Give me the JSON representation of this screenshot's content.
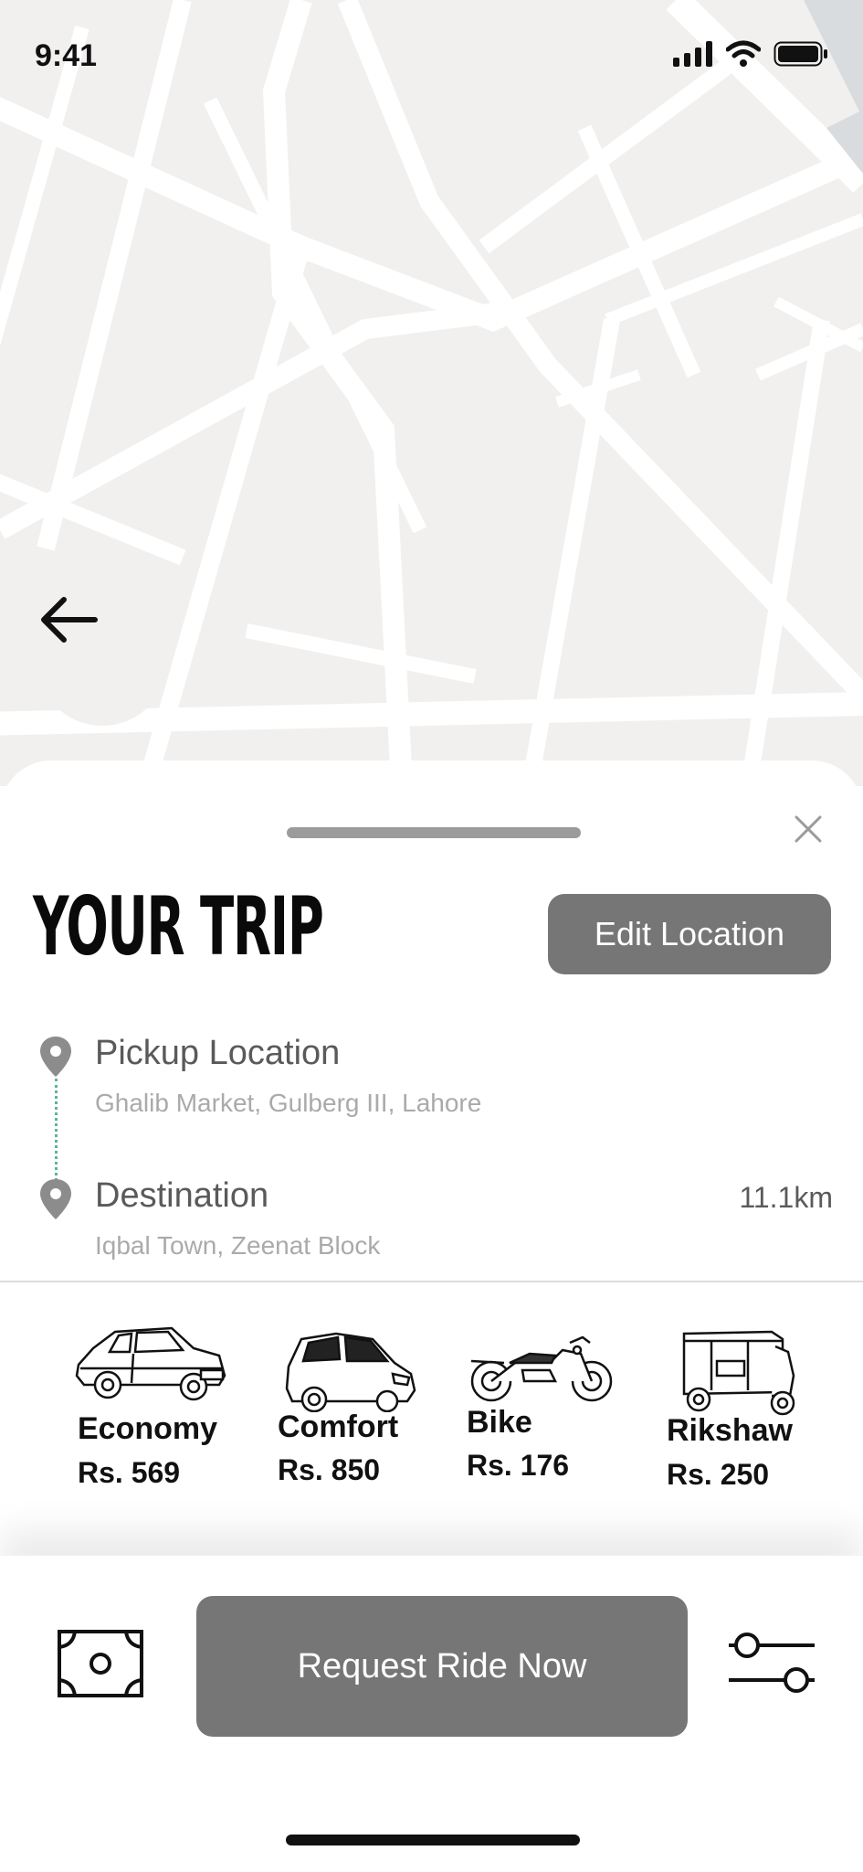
{
  "status_bar": {
    "time": "9:41"
  },
  "map": {
    "back_icon": "arrow-left-icon"
  },
  "trip_sheet": {
    "title": "YOUR TRIP",
    "edit_button_label": "Edit Location",
    "close_icon": "close-icon",
    "pickup": {
      "label": "Pickup Location",
      "value": "Ghalib Market, Gulberg III, Lahore"
    },
    "destination": {
      "label": "Destination",
      "value": "Iqbal Town, Zeenat Block",
      "distance": "11.1km"
    },
    "vehicles": [
      {
        "name": "Economy",
        "price": "Rs. 569",
        "icon": "sedan-car-icon"
      },
      {
        "name": "Comfort",
        "price": "Rs. 850",
        "icon": "hatchback-car-icon"
      },
      {
        "name": "Bike",
        "price": "Rs. 176",
        "icon": "motorcycle-icon"
      },
      {
        "name": "Rikshaw",
        "price": "Rs. 250",
        "icon": "rickshaw-icon"
      }
    ]
  },
  "bottom_bar": {
    "payment_icon": "cash-icon",
    "request_button_label": "Request Ride Now",
    "filter_icon": "sliders-icon"
  },
  "colors": {
    "button_gray": "#767676",
    "map_bg": "#f1f0ef",
    "route_dots": "#5ab59c"
  }
}
